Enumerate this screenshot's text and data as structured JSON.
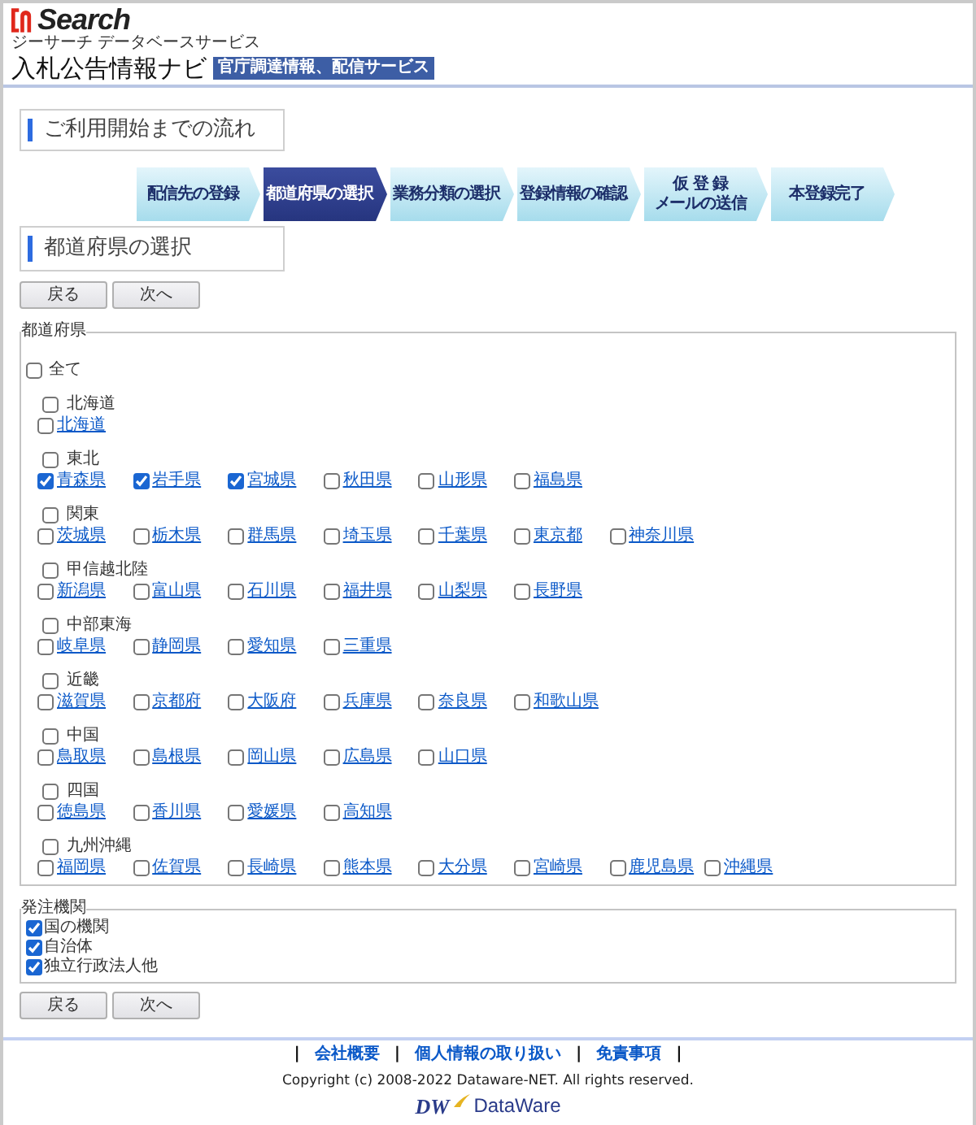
{
  "header": {
    "logo_text": "Search",
    "logo_subtitle": "ジーサーチ データベースサービス",
    "title": "入札公告情報ナビ",
    "badge": "官庁調達情報、配信サービス"
  },
  "flow_heading": "ご利用開始までの流れ",
  "steps": [
    {
      "lines": [
        "配信先の登録"
      ],
      "selected": false
    },
    {
      "lines": [
        "都道府県の選択"
      ],
      "selected": true
    },
    {
      "lines": [
        "業務分類の選択"
      ],
      "selected": false
    },
    {
      "lines": [
        "登録情報の確認"
      ],
      "selected": false
    },
    {
      "lines": [
        "仮 登 録",
        "メールの送信"
      ],
      "selected": false
    },
    {
      "lines": [
        "本登録完了"
      ],
      "selected": false
    }
  ],
  "section_heading": "都道府県の選択",
  "top_buttons": [
    "戻る",
    "次へ"
  ],
  "prefectures": {
    "legend": "都道府県",
    "all": {
      "label": "全て",
      "checked": false
    },
    "regions": [
      {
        "name": "北海道",
        "checked": false,
        "items": [
          {
            "name": "北海道",
            "checked": false
          }
        ]
      },
      {
        "name": "東北",
        "checked": false,
        "items": [
          {
            "name": "青森県",
            "checked": true
          },
          {
            "name": "岩手県",
            "checked": true
          },
          {
            "name": "宮城県",
            "checked": true
          },
          {
            "name": "秋田県",
            "checked": false
          },
          {
            "name": "山形県",
            "checked": false
          },
          {
            "name": "福島県",
            "checked": false
          }
        ]
      },
      {
        "name": "関東",
        "checked": false,
        "items": [
          {
            "name": "茨城県",
            "checked": false
          },
          {
            "name": "栃木県",
            "checked": false
          },
          {
            "name": "群馬県",
            "checked": false
          },
          {
            "name": "埼玉県",
            "checked": false
          },
          {
            "name": "千葉県",
            "checked": false
          },
          {
            "name": "東京都",
            "checked": false
          },
          {
            "name": "神奈川県",
            "checked": false
          }
        ]
      },
      {
        "name": "甲信越北陸",
        "checked": false,
        "items": [
          {
            "name": "新潟県",
            "checked": false
          },
          {
            "name": "富山県",
            "checked": false
          },
          {
            "name": "石川県",
            "checked": false
          },
          {
            "name": "福井県",
            "checked": false
          },
          {
            "name": "山梨県",
            "checked": false
          },
          {
            "name": "長野県",
            "checked": false
          }
        ]
      },
      {
        "name": "中部東海",
        "checked": false,
        "items": [
          {
            "name": "岐阜県",
            "checked": false
          },
          {
            "name": "静岡県",
            "checked": false
          },
          {
            "name": "愛知県",
            "checked": false
          },
          {
            "name": "三重県",
            "checked": false
          }
        ]
      },
      {
        "name": "近畿",
        "checked": false,
        "items": [
          {
            "name": "滋賀県",
            "checked": false
          },
          {
            "name": "京都府",
            "checked": false
          },
          {
            "name": "大阪府",
            "checked": false
          },
          {
            "name": "兵庫県",
            "checked": false
          },
          {
            "name": "奈良県",
            "checked": false
          },
          {
            "name": "和歌山県",
            "checked": false
          }
        ]
      },
      {
        "name": "中国",
        "checked": false,
        "items": [
          {
            "name": "鳥取県",
            "checked": false
          },
          {
            "name": "島根県",
            "checked": false
          },
          {
            "name": "岡山県",
            "checked": false
          },
          {
            "name": "広島県",
            "checked": false
          },
          {
            "name": "山口県",
            "checked": false
          }
        ]
      },
      {
        "name": "四国",
        "checked": false,
        "items": [
          {
            "name": "徳島県",
            "checked": false
          },
          {
            "name": "香川県",
            "checked": false
          },
          {
            "name": "愛媛県",
            "checked": false
          },
          {
            "name": "高知県",
            "checked": false
          }
        ]
      },
      {
        "name": "九州沖縄",
        "checked": false,
        "items": [
          {
            "name": "福岡県",
            "checked": false
          },
          {
            "name": "佐賀県",
            "checked": false
          },
          {
            "name": "長崎県",
            "checked": false
          },
          {
            "name": "熊本県",
            "checked": false
          },
          {
            "name": "大分県",
            "checked": false
          },
          {
            "name": "宮崎県",
            "checked": false
          },
          {
            "name": "鹿児島県",
            "checked": false
          },
          {
            "name": "沖縄県",
            "checked": false
          }
        ]
      }
    ]
  },
  "orderers": {
    "legend": "発注機関",
    "items": [
      {
        "label": "国の機関",
        "checked": true
      },
      {
        "label": "自治体",
        "checked": true
      },
      {
        "label": "独立行政法人他",
        "checked": true
      }
    ]
  },
  "bottom_buttons": [
    "戻る",
    "次へ"
  ],
  "footer": {
    "nav": [
      {
        "kind": "separator",
        "text": "|"
      },
      {
        "kind": "link",
        "text": "会社概要"
      },
      {
        "kind": "separator",
        "text": "|"
      },
      {
        "kind": "link",
        "text": "個人情報の取り扱い"
      },
      {
        "kind": "separator",
        "text": "|"
      },
      {
        "kind": "link",
        "text": "免責事項"
      },
      {
        "kind": "separator",
        "text": "|"
      }
    ],
    "copyright": "Copyright (c) 2008-2022 Dataware-NET. All rights reserved.",
    "logo_mark": "DW",
    "logo_text": "DataWare"
  }
}
